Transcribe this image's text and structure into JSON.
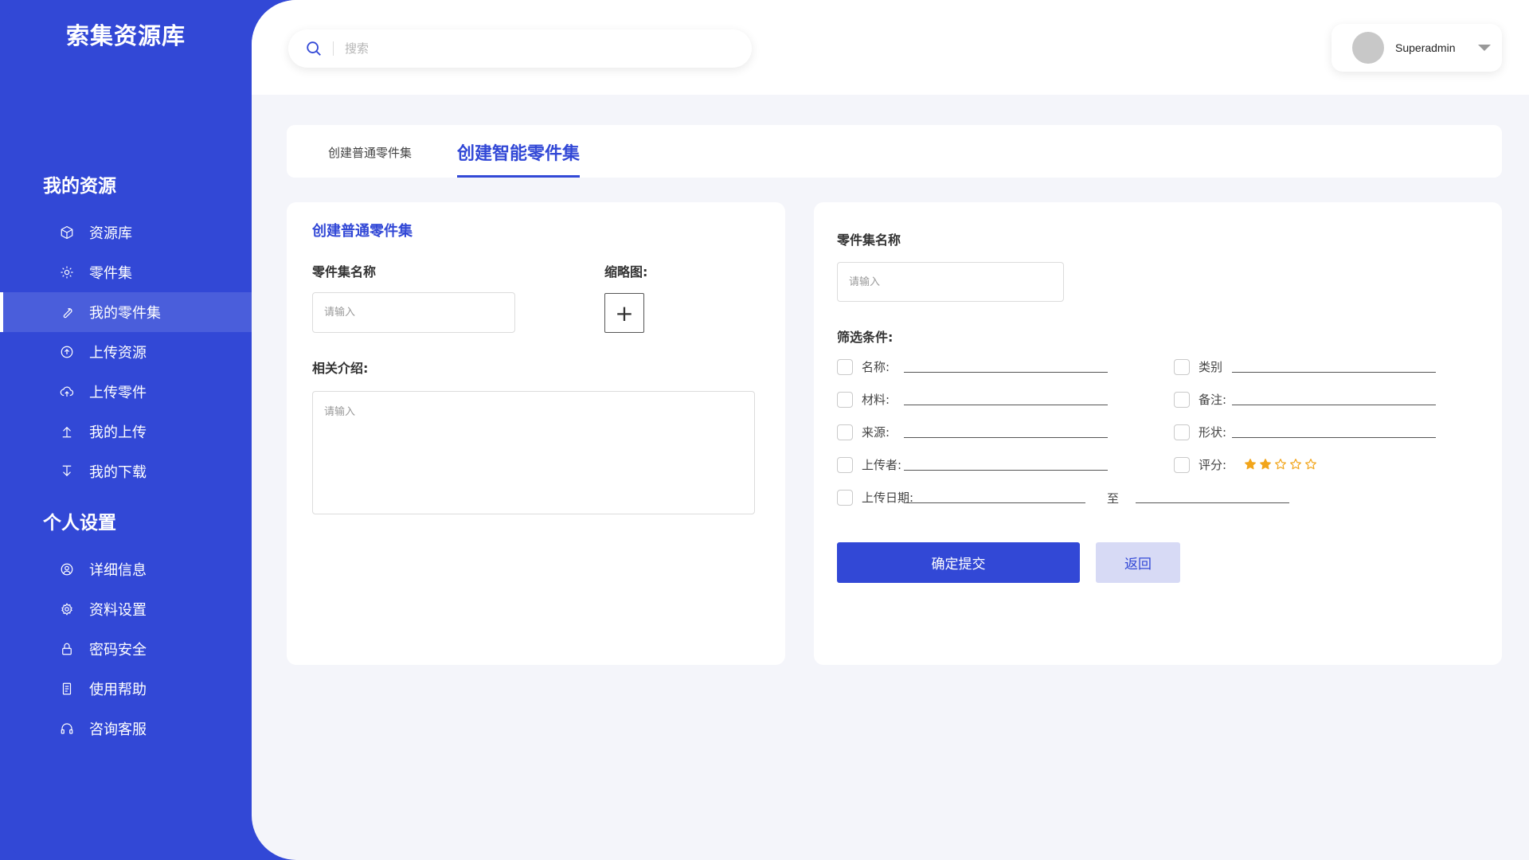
{
  "app": {
    "brand": "索集资源库"
  },
  "sidebar": {
    "section1_title": "我的资源",
    "section2_title": "个人设置",
    "items": [
      {
        "label": "资源库",
        "icon": "cube-icon"
      },
      {
        "label": "零件集",
        "icon": "gear-icon"
      },
      {
        "label": "我的零件集",
        "icon": "wrench-icon",
        "active": true
      },
      {
        "label": "上传资源",
        "icon": "upload-circle-icon"
      },
      {
        "label": "上传零件",
        "icon": "cloud-upload-icon"
      },
      {
        "label": "我的上传",
        "icon": "arrow-up-icon"
      },
      {
        "label": "我的下载",
        "icon": "arrow-down-icon"
      }
    ],
    "settings": [
      {
        "label": "详细信息",
        "icon": "user-circle-icon"
      },
      {
        "label": "资料设置",
        "icon": "settings-icon"
      },
      {
        "label": "密码安全",
        "icon": "lock-icon"
      },
      {
        "label": "使用帮助",
        "icon": "document-icon"
      },
      {
        "label": "咨询客服",
        "icon": "headset-icon"
      }
    ]
  },
  "header": {
    "search_placeholder": "搜索",
    "username": "Superadmin"
  },
  "tabs": {
    "tab1": "创建普通零件集",
    "tab2": "创建智能零件集"
  },
  "left_form": {
    "title": "创建普通零件集",
    "name_label": "零件集名称",
    "name_placeholder": "请输入",
    "thumb_label": "缩略图:",
    "thumb_plus": "+",
    "intro_label": "相关介绍:",
    "intro_placeholder": "请输入"
  },
  "right_form": {
    "name_label": "零件集名称",
    "name_placeholder": "请输入",
    "filter_label": "筛选条件:",
    "conditions": {
      "name": "名称:",
      "category": "类别",
      "material": "材料:",
      "note": "备注:",
      "source": "来源:",
      "shape": "形状:",
      "uploader": "上传者:",
      "rating": "评分:",
      "date": "上传日期:",
      "to": "至"
    },
    "rating_value": 2,
    "rating_max": 5,
    "submit": "确定提交",
    "back": "返回"
  },
  "colors": {
    "accent": "#3248d6",
    "star": "#f2a51a",
    "back_bg": "#d7daf5"
  }
}
